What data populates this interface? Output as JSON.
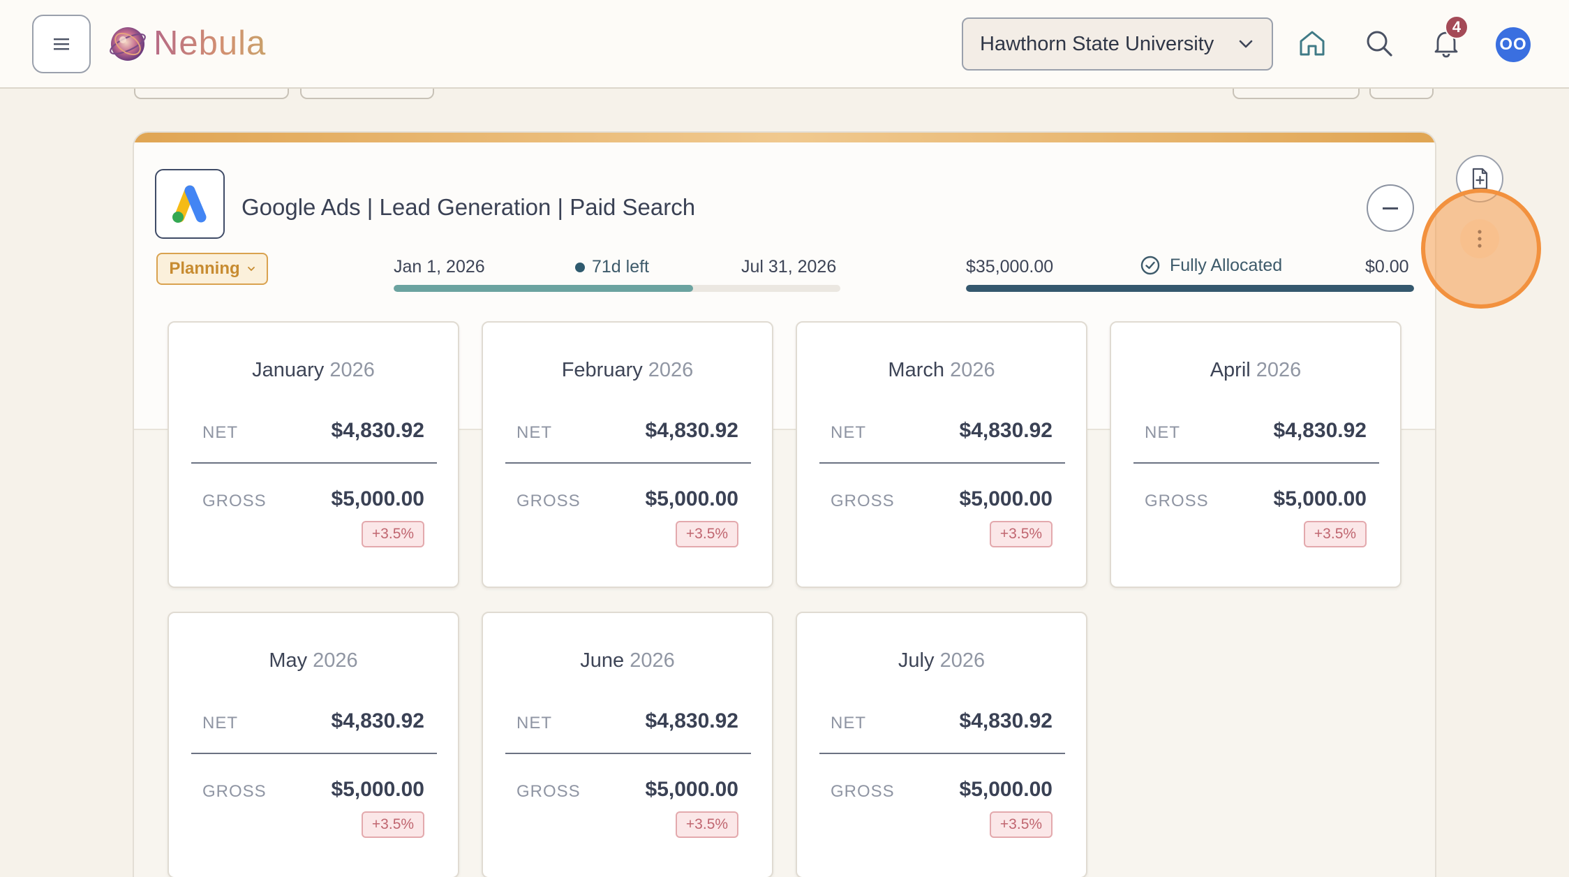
{
  "app": {
    "name": "Nebula",
    "organization": "Hawthorn State University",
    "notification_count": "4",
    "user_initials": "OO"
  },
  "icons": {
    "menu": "hamburger-icon",
    "org_dropdown": "chevron-down-icon",
    "home": "home-icon",
    "search": "search-icon",
    "notifications": "bell-icon",
    "platform": "google-ads-logo",
    "status_dropdown": "chevron-down-icon",
    "allocated": "check-circle-icon",
    "collapse": "minus-icon",
    "add_document": "file-plus-icon",
    "more": "vertical-ellipsis-icon"
  },
  "colors": {
    "accent": "#e0a553",
    "status_planning": "#c78b30",
    "time_progress": "#6ba3a0",
    "budget_progress": "#35586e",
    "badge_text": "#c06670",
    "notification_badge": "#a44a57",
    "avatar": "#3a6fe0",
    "highlight": "#f2913e"
  },
  "campaign": {
    "title": "Google Ads | Lead Generation | Paid Search",
    "status": "Planning",
    "start_date": "Jan 1, 2026",
    "days_left": "71d left",
    "end_date": "Jul 31, 2026",
    "time_elapsed_fraction": 0.67,
    "budget_total": "$35,000.00",
    "allocation_status": "Fully Allocated",
    "budget_remaining": "$0.00",
    "budget_allocated_fraction": 1.0
  },
  "months": [
    {
      "month": "January",
      "year": "2026",
      "net_label": "NET",
      "net": "$4,830.92",
      "gross_label": "GROSS",
      "gross": "$5,000.00",
      "change": "+3.5%"
    },
    {
      "month": "February",
      "year": "2026",
      "net_label": "NET",
      "net": "$4,830.92",
      "gross_label": "GROSS",
      "gross": "$5,000.00",
      "change": "+3.5%"
    },
    {
      "month": "March",
      "year": "2026",
      "net_label": "NET",
      "net": "$4,830.92",
      "gross_label": "GROSS",
      "gross": "$5,000.00",
      "change": "+3.5%"
    },
    {
      "month": "April",
      "year": "2026",
      "net_label": "NET",
      "net": "$4,830.92",
      "gross_label": "GROSS",
      "gross": "$5,000.00",
      "change": "+3.5%"
    },
    {
      "month": "May",
      "year": "2026",
      "net_label": "NET",
      "net": "$4,830.92",
      "gross_label": "GROSS",
      "gross": "$5,000.00",
      "change": "+3.5%"
    },
    {
      "month": "June",
      "year": "2026",
      "net_label": "NET",
      "net": "$4,830.92",
      "gross_label": "GROSS",
      "gross": "$5,000.00",
      "change": "+3.5%"
    },
    {
      "month": "July",
      "year": "2026",
      "net_label": "NET",
      "net": "$4,830.92",
      "gross_label": "GROSS",
      "gross": "$5,000.00",
      "change": "+3.5%"
    }
  ]
}
